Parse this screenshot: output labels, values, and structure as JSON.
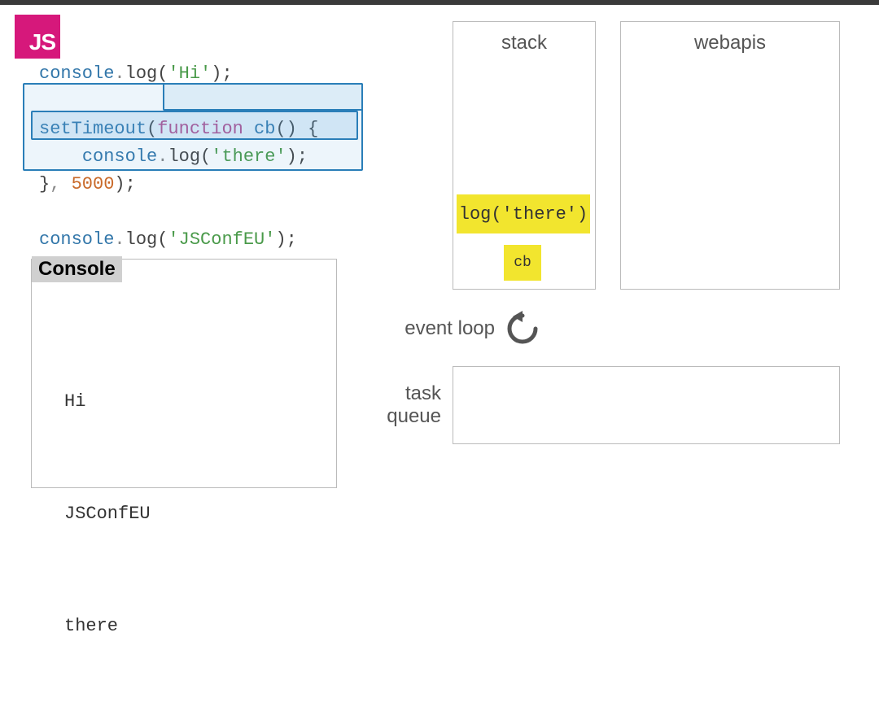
{
  "logo": "JS",
  "code": {
    "line1_pre": "console",
    "line1_dot": ".",
    "line1_method": "log",
    "line1_open": "(",
    "line1_str": "'Hi'",
    "line1_close": ");",
    "line2_ident": "setTimeout",
    "line2_open": "(",
    "line2_kw": "function",
    "line2_fn": " cb",
    "line2_sig": "() {",
    "line3_indent": "    ",
    "line3_console": "console",
    "line3_dot": ".",
    "line3_method": "log",
    "line3_open": "(",
    "line3_str": "'there'",
    "line3_close": ");",
    "line4_close": "}",
    "line4_comma": ", ",
    "line4_num": "5000",
    "line4_end": ");",
    "line5_console": "console",
    "line5_dot": ".",
    "line5_method": "log",
    "line5_open": "(",
    "line5_str": "'JSConfEU'",
    "line5_close": ");"
  },
  "console": {
    "title": "Console",
    "out1": "Hi",
    "out2": "JSConfEU",
    "out3": "there"
  },
  "stack": {
    "title": "stack",
    "frame_top": "log('there')",
    "frame_bottom": "cb"
  },
  "webapis": {
    "title": "webapis"
  },
  "eventloop": {
    "label": "event loop"
  },
  "queue": {
    "label": "task\nqueue"
  },
  "colors": {
    "highlight": "#f2e52e",
    "logo_bg": "#d6187b",
    "selection": "#2a7eb8"
  }
}
